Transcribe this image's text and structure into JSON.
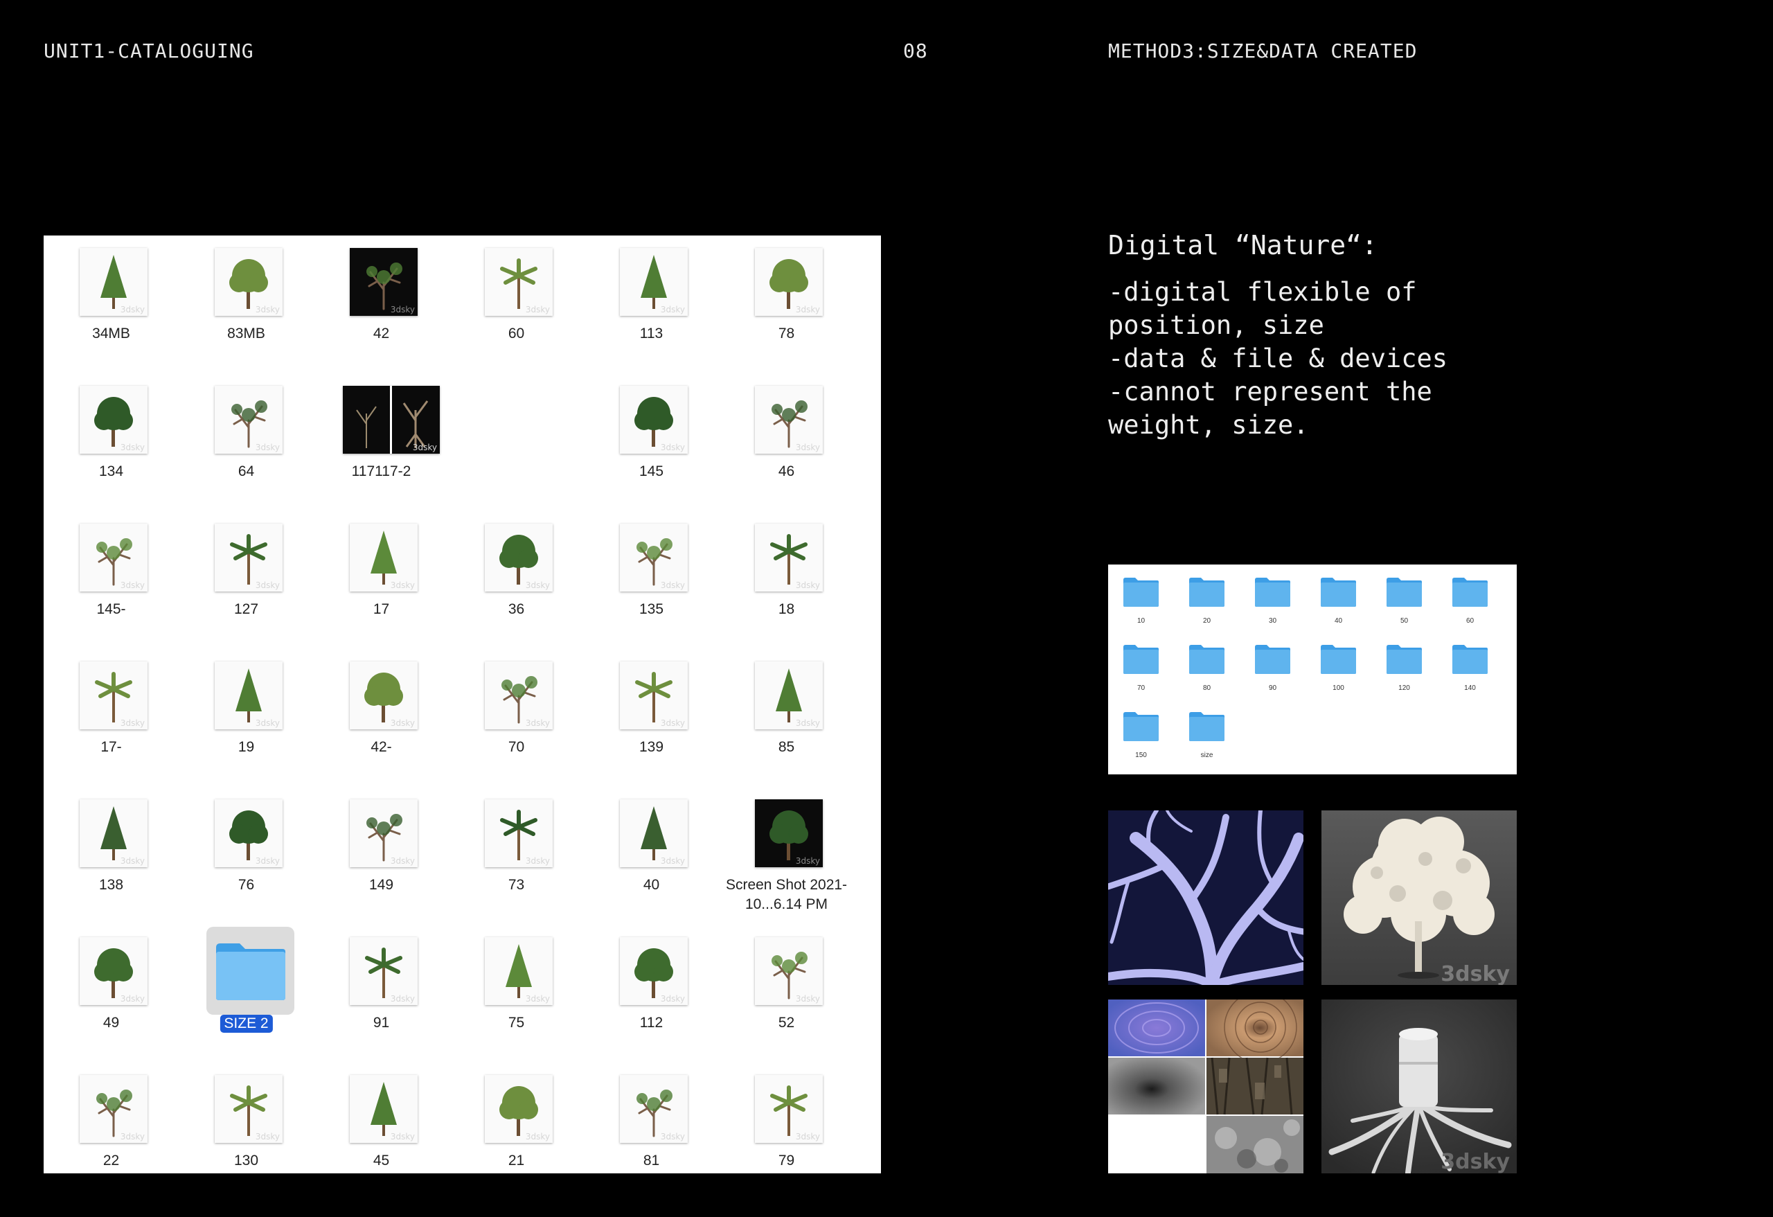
{
  "header": {
    "left": "UNIT1-CATALOGUING",
    "center": "08",
    "right": "METHOD3:SIZE&DATA CREATED"
  },
  "right_text": {
    "title": "Digital “Nature“:",
    "lines": [
      "-digital flexible of",
      "position, size",
      "-data & file & devices",
      "-cannot represent the",
      "weight, size."
    ]
  },
  "grid": {
    "rows": [
      [
        "34MB",
        "83MB",
        "42",
        "60",
        "113",
        "78"
      ],
      [
        "134",
        "64",
        "117117-2",
        "",
        "145",
        "46"
      ],
      [
        "145-",
        "127",
        "17",
        "36",
        "135",
        "18"
      ],
      [
        "17-",
        "19",
        "42-",
        "70",
        "139",
        "85"
      ],
      [
        "138",
        "76",
        "149",
        "73",
        "40",
        "Screen Shot 2021-10...6.14 PM"
      ],
      [
        "49",
        "SIZE 2",
        "91",
        "75",
        "112",
        "52"
      ],
      [
        "22",
        "130",
        "45",
        "21",
        "81",
        "79"
      ]
    ],
    "watermark": "3dsky"
  },
  "folders": {
    "labels": [
      "10",
      "20",
      "30",
      "40",
      "50",
      "60",
      "70",
      "80",
      "90",
      "100",
      "120",
      "140",
      "150",
      "size"
    ],
    "color": "#5fb4ee"
  },
  "images": {
    "watermark": "3dsky"
  }
}
